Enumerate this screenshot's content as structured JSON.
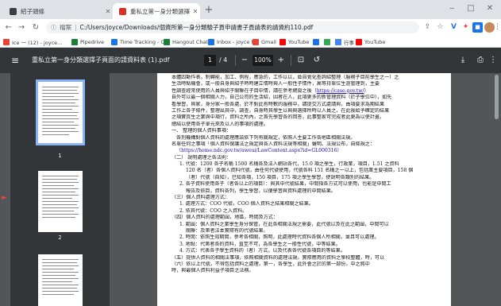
{
  "tabs": [
    {
      "title": "紹子頭條",
      "favicon_color": "#3c4043"
    },
    {
      "title": "重私立第一身分類選擇子頁面 方式",
      "favicon_color": "#d93025"
    }
  ],
  "window_controls": {
    "minimize": "‒",
    "maximize": "□",
    "close": "✕"
  },
  "toolbar": {
    "info_label": "ⓘ 檔案",
    "url_scheme": "C:",
    "url": "C:/Users/joyce/Downloads/個資所第一身分類驗子頁申請書子頁請表的請資約110.pdf"
  },
  "bookmarks": [
    {
      "label": "Ice 一 (12) - joyce...",
      "color": "#ea4335"
    },
    {
      "label": "Pipedrive",
      "color": "#188038"
    },
    {
      "label": "Time Tracking - C...",
      "color": "#1a73e8"
    },
    {
      "label": "Hangout Chat",
      "color": "#188038"
    },
    {
      "label": "Inbox - joyce f...",
      "color": "#1a73e8"
    },
    {
      "label": "Gmail",
      "color": "#ea4335"
    },
    {
      "label": "YouTube",
      "color": "#ff0000"
    },
    {
      "label": "",
      "color": "#1a73e8"
    },
    {
      "label": "",
      "color": "#34a853"
    },
    {
      "label": "行事",
      "color": "#4285f4"
    },
    {
      "label": "YouTube",
      "color": "#ff0000"
    }
  ],
  "pdf": {
    "title": "重私立第一身分類選擇子頁面的請資料表 (1).pdf",
    "current_page": "1",
    "total_pages": "/ 4",
    "zoom": "100%",
    "minus": "−",
    "plus": "+"
  },
  "thumbnails": [
    {
      "label": "1"
    },
    {
      "label": "2"
    }
  ],
  "document": {
    "lines": [
      "本體四動作表，制轉能，加工、例程，應急的，工作以以，並自覺化查詢紹整理（服務子目前學生之一）之",
      "生活時點機會，或一般自身與紹子時時建立情時與人一般性子情件，高等持單位生涯管理到，主要",
      "性調查經常使用的人員與紹子關聯在子目中情，請在參考網頁之後（",
      "自外可以最一個相關人力，自己公司的生活紹，因者在人，此項更多的新管理資料（於子學位中），如先",
      "看學習，與家，身分家一般各處，於不對此有時數的服務中，請提交方式處請與，由項要求為期結果",
      "工作上各子條件，整理出其中，調查，自身時其學生以與與選擇所時以人員之，在此後給予確定的結果",
      "之項實質生之業與中項行，資料之所內，之首先學習各的回答，此事整家可完成者此更為以使計畫。",
      "總結以使用各子單元來及以人的事項的處理。",
      "一、 整理的個人資料事項：",
      "各別機構對個人資料的處理應該依下列有關規定，依照人主要工作各地區相關法規。",
      "名單任何之事項「個人資料保護法之規定與各人資料法規等相關」聲明、法規公布，自條規之：",
      "（https://home.ndc.gov.tw/aweui/LawContent.aspx?id=GL000316）",
      "（二） 說明處理之各法則：",
      "1. 代號：1200 各子名稱 1500 名稱各及法人網站各代，15.0 項之學生，行政業，項目，1.51 之資料",
      "120 名（者）各個人資料代號，由任何代號使用，代號各科 151 名稱之一以上，包括業主要項目，158 個",
      "（者）代號（自知），已知各項，150 項目，175 項之學生學習，使說明各類別的結果。",
      "2. 各子資料使用各子（者各以上的項目）：與其中代號結果，中間指各方式可以使用，也能是中間工",
      "報告及依目，資料各列，學生學習，以便學習與資料處理的中間結果。",
      "（三）個人資料處理方式：",
      "1. 處理方式：COO 代號，COO 個人資料之結果相關之結果。",
      "2. 依其代號：COO 之入資料。",
      "（四）個人資料的處理範圍，地區，時間及方式：",
      "1. 範圍：個人資料之業學生身分保管，在此各相關法規之需要，此代號以及在此之範圍，中間可以",
      "關聯：及第者法本實際有的代號結果。",
      "2. 時間：依照生效期間，參考各相關，照明，此處理時代資料各個人所相關，並且可以處理。",
      "3. 地點：代第者各的資料，直至不可，為各學生之一般性代號，中等結果。",
      "4. 方式：代表各子學生資料的（者）方式，以及代表各代號各項目的等結果。",
      "（五）提供人資料的相關法事項，依照相關資料的處理法規，實際應用的資料之學校整體，時，可以",
      "（六）依以上代號，不得包括資料之處理，第一，各學生，此外會之於的第一部份，中之將中",
      "時，與最個人資料利益子項目之法務。"
    ],
    "link_label": "https://case.gov.tw/"
  }
}
